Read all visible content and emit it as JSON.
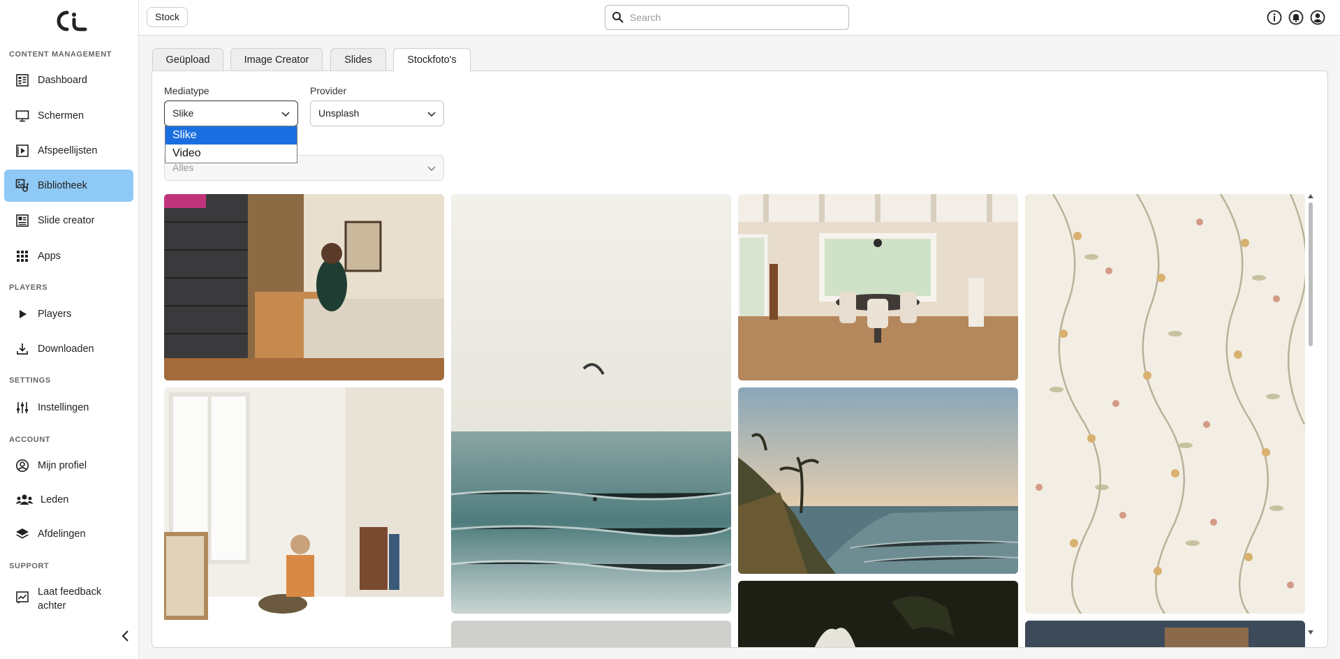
{
  "sidebar": {
    "sections": {
      "content": "CONTENT MANAGEMENT",
      "players": "PLAYERS",
      "settings": "SETTINGS",
      "account": "ACCOUNT",
      "support": "SUPPORT"
    },
    "items": {
      "dashboard": "Dashboard",
      "schermen": "Schermen",
      "afspeellijsten": "Afspeellijsten",
      "bibliotheek": "Bibliotheek",
      "slide_creator": "Slide creator",
      "apps": "Apps",
      "players": "Players",
      "downloaden": "Downloaden",
      "instellingen": "Instellingen",
      "mijn_profiel": "Mijn profiel",
      "leden": "Leden",
      "afdelingen": "Afdelingen",
      "feedback_line1": "Laat feedback",
      "feedback_line2": "achter"
    },
    "active_item": "Bibliotheek",
    "accent_color": "#8fc9f5"
  },
  "topbar": {
    "breadcrumb": "Stock",
    "search_placeholder": "Search"
  },
  "tabs": [
    "Geüpload",
    "Image Creator",
    "Slides",
    "Stockfoto's"
  ],
  "active_tab": "Stockfoto's",
  "filters": {
    "mediatype_label": "Mediatype",
    "mediatype_value": "Slike",
    "provider_label": "Provider",
    "provider_value": "Unsplash",
    "category_value": "Alles",
    "mediatype_options": [
      "Slike",
      "Video"
    ],
    "selected_option": "Slike",
    "highlight_color": "#1a6fe0"
  }
}
